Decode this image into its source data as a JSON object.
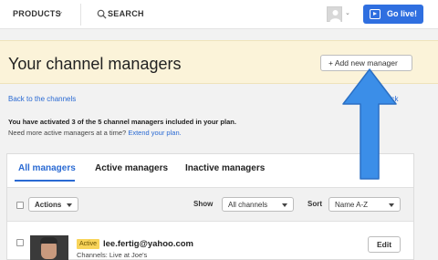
{
  "topbar": {
    "products_label": "PRODUCTS",
    "search_label": "SEARCH",
    "go_live_label": "Go live!",
    "brand_color": "#2f6fe0"
  },
  "header": {
    "title": "Your channel managers",
    "add_button_label": "+ Add new manager"
  },
  "links": {
    "back": "Back to the channels",
    "feedback": "feedback"
  },
  "info": {
    "line1": "You have activated 3 of the 5 channel managers included in your plan.",
    "line2_prefix": "Need more active managers at a time?",
    "line2_link": "Extend your plan."
  },
  "tabs": [
    {
      "label": "All managers",
      "active": true
    },
    {
      "label": "Active managers",
      "active": false
    },
    {
      "label": "Inactive managers",
      "active": false
    }
  ],
  "toolbar": {
    "actions_label": "Actions",
    "show_label": "Show",
    "show_value": "All channels",
    "sort_label": "Sort",
    "sort_value": "Name A-Z"
  },
  "managers": [
    {
      "status": "Active",
      "email": "lee.fertig@yahoo.com",
      "channels": "Channels: Live at Joe's",
      "edit_label": "Edit"
    }
  ],
  "annotation": {
    "arrow_color": "#3b8ee8",
    "icon": "arrow-up-icon"
  }
}
